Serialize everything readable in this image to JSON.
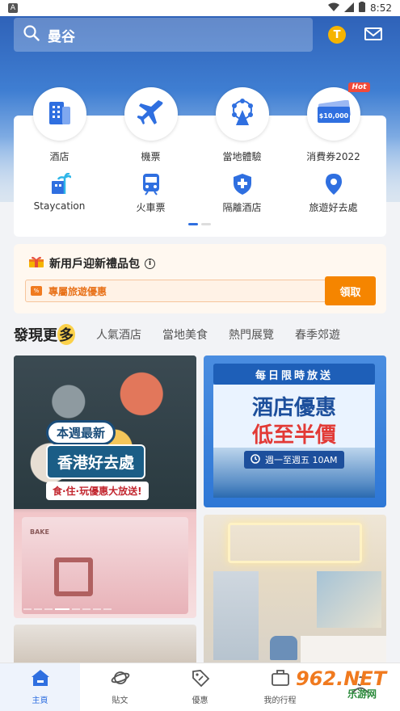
{
  "status_bar": {
    "time": "8:52",
    "notification_icon": "A"
  },
  "search": {
    "value": "曼谷"
  },
  "coin": {
    "label": "T"
  },
  "categories_main": [
    {
      "label": "酒店",
      "icon": "hotel-icon"
    },
    {
      "label": "機票",
      "icon": "flight-icon"
    },
    {
      "label": "當地體驗",
      "icon": "ferris-wheel-icon"
    },
    {
      "label": "消費券2022",
      "icon": "voucher-icon",
      "badge": "Hot",
      "voucher_text": "$10,000"
    }
  ],
  "categories_secondary": [
    {
      "label": "Staycation",
      "icon": "beach-icon"
    },
    {
      "label": "火車票",
      "icon": "train-icon"
    },
    {
      "label": "隔離酒店",
      "icon": "medical-shield-icon"
    },
    {
      "label": "旅遊好去處",
      "icon": "map-pin-icon"
    }
  ],
  "gift": {
    "title": "新用戶迎新禮品包",
    "info_icon": "i",
    "promo_tag": "%",
    "promo_text": "專屬旅遊優惠",
    "claim_label": "領取"
  },
  "discover_tabs": {
    "active_prefix": "發現更",
    "active_suffix": "多",
    "items": [
      "人氣酒店",
      "當地美食",
      "熱門展覽",
      "春季郊遊"
    ]
  },
  "feed": {
    "card1": {
      "line1": "本週最新",
      "line2": "香港好去處",
      "line3": "食·住·玩優惠大放送!",
      "shop_sign": "BAKE"
    },
    "card2": {
      "ribbon": "每日限時放送",
      "headline1": "酒店優惠",
      "headline2": "低至半價",
      "time": "週一至週五 10AM"
    }
  },
  "tab_bar": [
    {
      "label": "主頁",
      "icon": "home-icon",
      "active": true
    },
    {
      "label": "貼文",
      "icon": "planet-icon",
      "active": false
    },
    {
      "label": "優惠",
      "icon": "tag-icon",
      "active": false
    },
    {
      "label": "我的行程",
      "icon": "suitcase-icon",
      "active": false
    }
  ],
  "watermark": {
    "brand": "962.NET",
    "sub": "乐游网"
  },
  "colors": {
    "accent": "#2f6fe0",
    "orange": "#f58500",
    "hot_red": "#f04a3a"
  }
}
